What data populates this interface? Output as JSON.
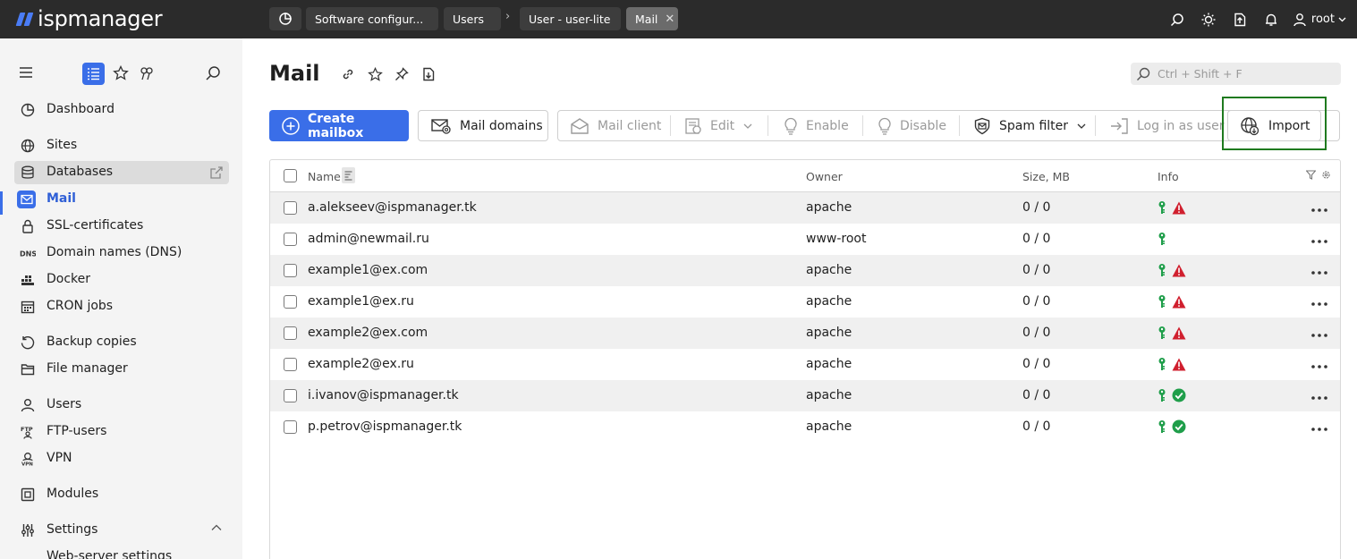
{
  "app": {
    "logo_text": "ispmanager",
    "colors": {
      "accent": "#3a6ee8",
      "topbar": "#2b2b2b",
      "warning": "#d01f2e",
      "ok": "#1f9e4a",
      "highlight": "#1f7a1f"
    }
  },
  "topbar": {
    "tabs": [
      {
        "label": "Software configur...",
        "active": false
      },
      {
        "label": "Users",
        "active": false
      },
      {
        "label": "User - user-lite",
        "active": false
      },
      {
        "label": "Mail",
        "active": true
      }
    ],
    "separator": "›",
    "icons": [
      "search-icon",
      "theme-icon",
      "export-icon",
      "bell-icon",
      "user-icon"
    ],
    "user": "root"
  },
  "sidebar": {
    "tools": [
      "menu-icon",
      "list-icon",
      "star-icon",
      "pin-icon",
      "search-icon"
    ],
    "items": [
      {
        "label": "Dashboard",
        "icon": "dashboard-icon"
      },
      {
        "label": "Sites",
        "icon": "globe-icon"
      },
      {
        "label": "Databases",
        "icon": "database-icon"
      },
      {
        "label": "Mail",
        "icon": "mail-icon"
      },
      {
        "label": "SSL-certificates",
        "icon": "lock-icon"
      },
      {
        "label": "Domain names (DNS)",
        "icon": "dns-icon"
      },
      {
        "label": "Docker",
        "icon": "docker-icon"
      },
      {
        "label": "CRON jobs",
        "icon": "calendar-icon"
      },
      {
        "label": "Backup copies",
        "icon": "backup-icon"
      },
      {
        "label": "File manager",
        "icon": "folder-icon"
      },
      {
        "label": "Users",
        "icon": "user-icon"
      },
      {
        "label": "FTP-users",
        "icon": "ftp-icon"
      },
      {
        "label": "VPN",
        "icon": "vpn-icon"
      },
      {
        "label": "Modules",
        "icon": "modules-icon"
      },
      {
        "label": "Settings",
        "icon": "settings-icon"
      },
      {
        "label": "Web-server settings",
        "icon": ""
      }
    ]
  },
  "main": {
    "title": "Mail",
    "search_placeholder": "Ctrl + Shift + F",
    "toolbar": {
      "create": "Create mailbox",
      "domains": "Mail domains",
      "client": "Mail client",
      "edit": "Edit",
      "enable": "Enable",
      "disable": "Disable",
      "spam": "Spam filter",
      "login": "Log in as user",
      "import": "Import"
    },
    "table": {
      "columns": {
        "name": "Name",
        "owner": "Owner",
        "size": "Size, MB",
        "info": "Info"
      },
      "rows": [
        {
          "name": "a.alekseev@ispmanager.tk",
          "owner": "apache",
          "size": "0 / 0",
          "status": "warning"
        },
        {
          "name": "admin@newmail.ru",
          "owner": "www-root",
          "size": "0 / 0",
          "status": "none"
        },
        {
          "name": "example1@ex.com",
          "owner": "apache",
          "size": "0 / 0",
          "status": "warning"
        },
        {
          "name": "example1@ex.ru",
          "owner": "apache",
          "size": "0 / 0",
          "status": "warning"
        },
        {
          "name": "example2@ex.com",
          "owner": "apache",
          "size": "0 / 0",
          "status": "warning"
        },
        {
          "name": "example2@ex.ru",
          "owner": "apache",
          "size": "0 / 0",
          "status": "warning"
        },
        {
          "name": "i.ivanov@ispmanager.tk",
          "owner": "apache",
          "size": "0 / 0",
          "status": "ok"
        },
        {
          "name": "p.petrov@ispmanager.tk",
          "owner": "apache",
          "size": "0 / 0",
          "status": "ok"
        }
      ]
    }
  }
}
